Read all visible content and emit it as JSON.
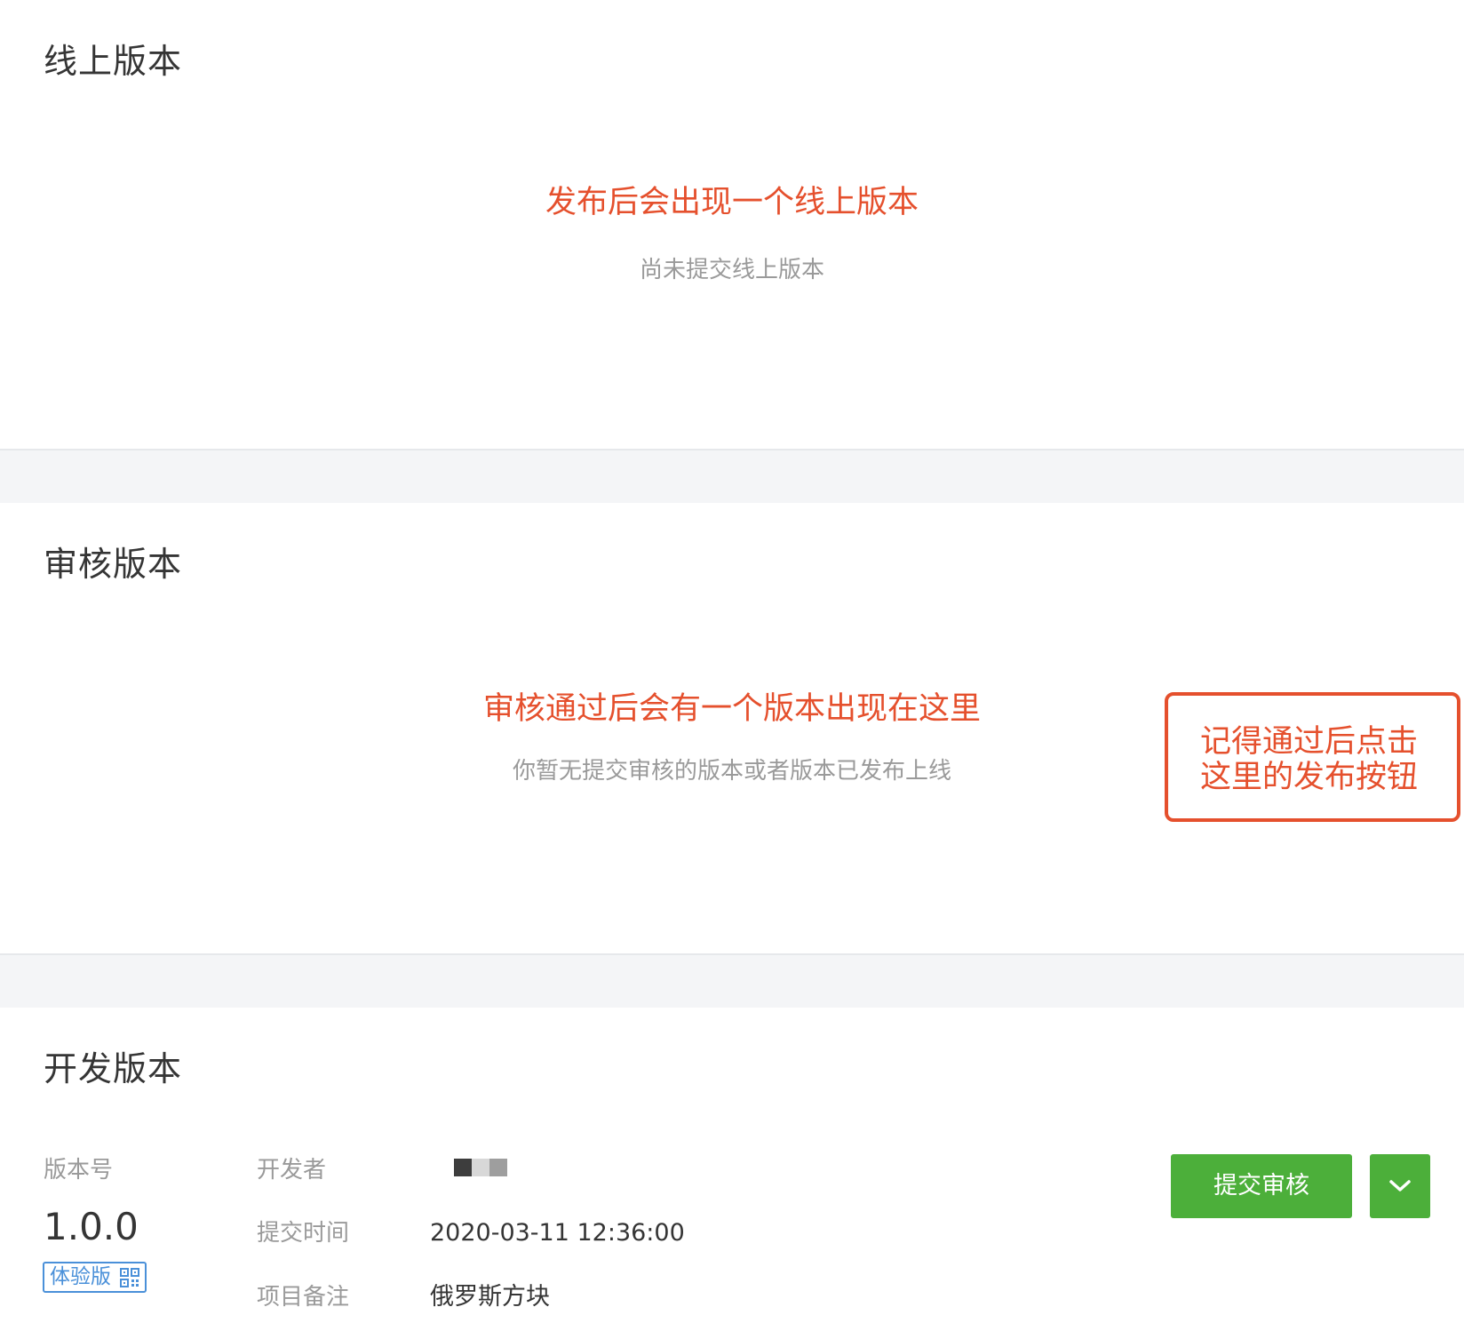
{
  "online_section": {
    "title": "线上版本",
    "annotation": "发布后会出现一个线上版本",
    "empty_text": "尚未提交线上版本"
  },
  "review_section": {
    "title": "审核版本",
    "annotation": "审核通过后会有一个版本出现在这里",
    "empty_text": "你暂无提交审核的版本或者版本已发布上线",
    "callout_line1": "记得通过后点击",
    "callout_line2": "这里的发布按钮"
  },
  "dev_section": {
    "title": "开发版本",
    "version_label": "版本号",
    "version_value": "1.0.0",
    "trial_badge": "体验版",
    "developer_label": "开发者",
    "submit_time_label": "提交时间",
    "submit_time_value": "2020-03-11 12:36:00",
    "remark_label": "项目备注",
    "remark_value": "俄罗斯方块",
    "submit_button": "提交审核",
    "more_icon": "chevron-down-icon",
    "qr_icon": "qrcode-icon"
  },
  "colors": {
    "annotation_red": "#e5502d",
    "primary_green": "#4caf3a",
    "badge_blue": "#4a90d9"
  }
}
